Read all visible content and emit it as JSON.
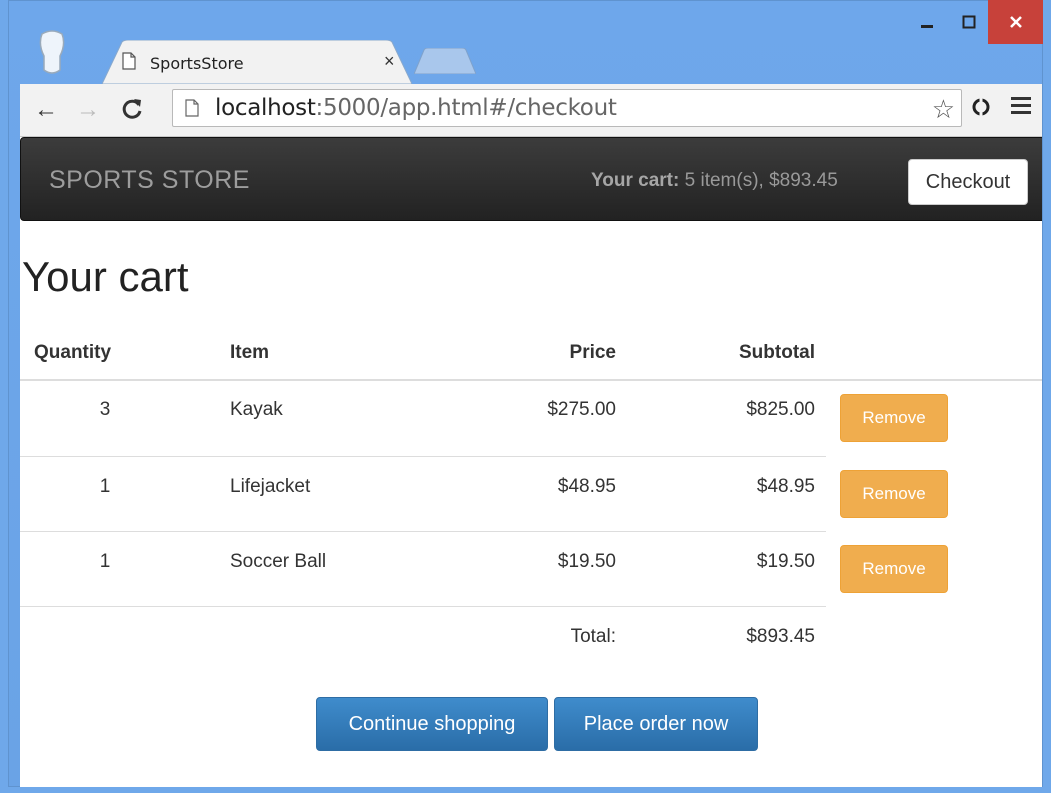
{
  "browser": {
    "tab_title": "SportsStore",
    "tab_close": "×",
    "url_host": "localhost",
    "url_rest": ":5000/app.html#/checkout",
    "window_controls": {
      "minimize": "–",
      "maximize": "□",
      "close": "×"
    }
  },
  "navbar": {
    "brand": "SPORTS STORE",
    "cart_label": "Your cart:",
    "cart_text": " 5 item(s), $893.45",
    "checkout_label": "Checkout"
  },
  "cart": {
    "title": "Your cart",
    "headers": {
      "quantity": "Quantity",
      "item": "Item",
      "price": "Price",
      "subtotal": "Subtotal"
    },
    "rows": [
      {
        "quantity": "3",
        "item": "Kayak",
        "price": "$275.00",
        "subtotal": "$825.00",
        "action": "Remove"
      },
      {
        "quantity": "1",
        "item": "Lifejacket",
        "price": "$48.95",
        "subtotal": "$48.95",
        "action": "Remove"
      },
      {
        "quantity": "1",
        "item": "Soccer Ball",
        "price": "$19.50",
        "subtotal": "$19.50",
        "action": "Remove"
      }
    ],
    "total_label": "Total:",
    "total_value": "$893.45"
  },
  "actions": {
    "continue_label": "Continue shopping",
    "place_order_label": "Place order now"
  },
  "colors": {
    "remove": "#f0ad4e",
    "primary": "#337ab7",
    "navbar": "#222222"
  }
}
